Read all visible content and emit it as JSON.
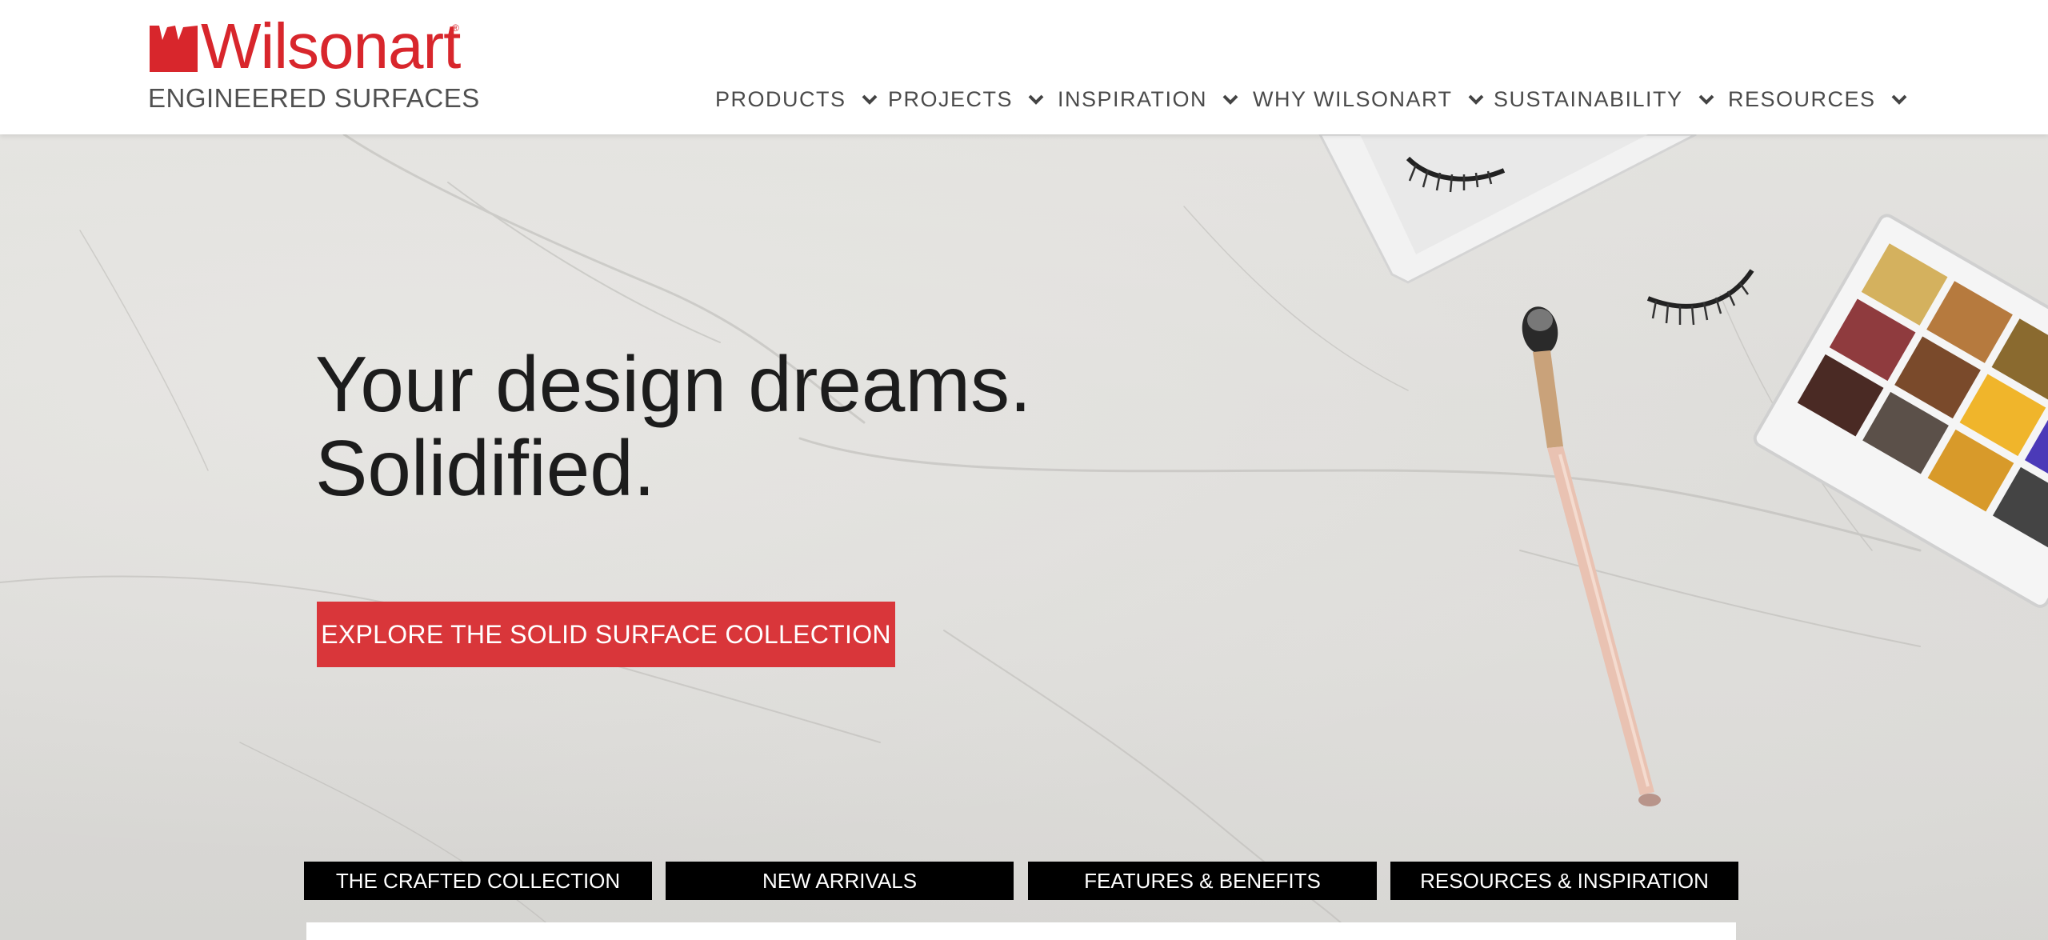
{
  "header": {
    "logo": {
      "brand": "Wilsonart",
      "registered": "®",
      "tagline": "ENGINEERED SURFACES"
    },
    "nav": [
      {
        "label": "PRODUCTS",
        "icon": "chevron-down-icon"
      },
      {
        "label": "PROJECTS",
        "icon": "chevron-down-icon"
      },
      {
        "label": "INSPIRATION",
        "icon": "chevron-down-icon"
      },
      {
        "label": "WHY WILSONART",
        "icon": "chevron-down-icon"
      },
      {
        "label": "SUSTAINABILITY",
        "icon": "chevron-down-icon"
      },
      {
        "label": "RESOURCES",
        "icon": "chevron-down-icon"
      }
    ]
  },
  "hero": {
    "headline_line1": "Your design dreams.",
    "headline_line2": "Solidified.",
    "cta_label": "EXPLORE THE SOLID SURFACE COLLECTION"
  },
  "tabs": [
    {
      "label": "THE CRAFTED COLLECTION"
    },
    {
      "label": "NEW ARRIVALS"
    },
    {
      "label": "FEATURES & BENEFITS"
    },
    {
      "label": "RESOURCES & INSPIRATION"
    }
  ],
  "colors": {
    "brand_red": "#d8262c",
    "cta_red": "#d9363a",
    "tab_bg": "#000000",
    "nav_text": "#4a4a4a"
  }
}
